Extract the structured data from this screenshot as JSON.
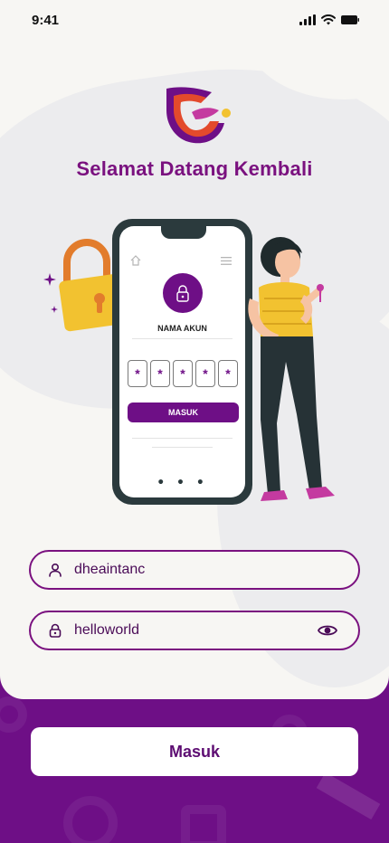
{
  "status_bar": {
    "time": "9:41"
  },
  "header": {
    "title": "Selamat Datang Kembali"
  },
  "illustration": {
    "account_label": "NAMA AKUN",
    "pin_chars": [
      "*",
      "*",
      "*",
      "*",
      "*"
    ],
    "button_label": "MASUK",
    "dots": "• • •"
  },
  "form": {
    "username": {
      "value": "dheaintanc",
      "icon": "user-icon"
    },
    "password": {
      "value": "helloworld",
      "icon": "lock-icon",
      "toggle_icon": "eye-icon"
    }
  },
  "submit": {
    "label": "Masuk"
  },
  "colors": {
    "primary": "#6e0f86",
    "title": "#7a117f",
    "background": "#f7f6f3",
    "accent_yellow": "#f2c230",
    "accent_orange": "#e27c2c"
  }
}
